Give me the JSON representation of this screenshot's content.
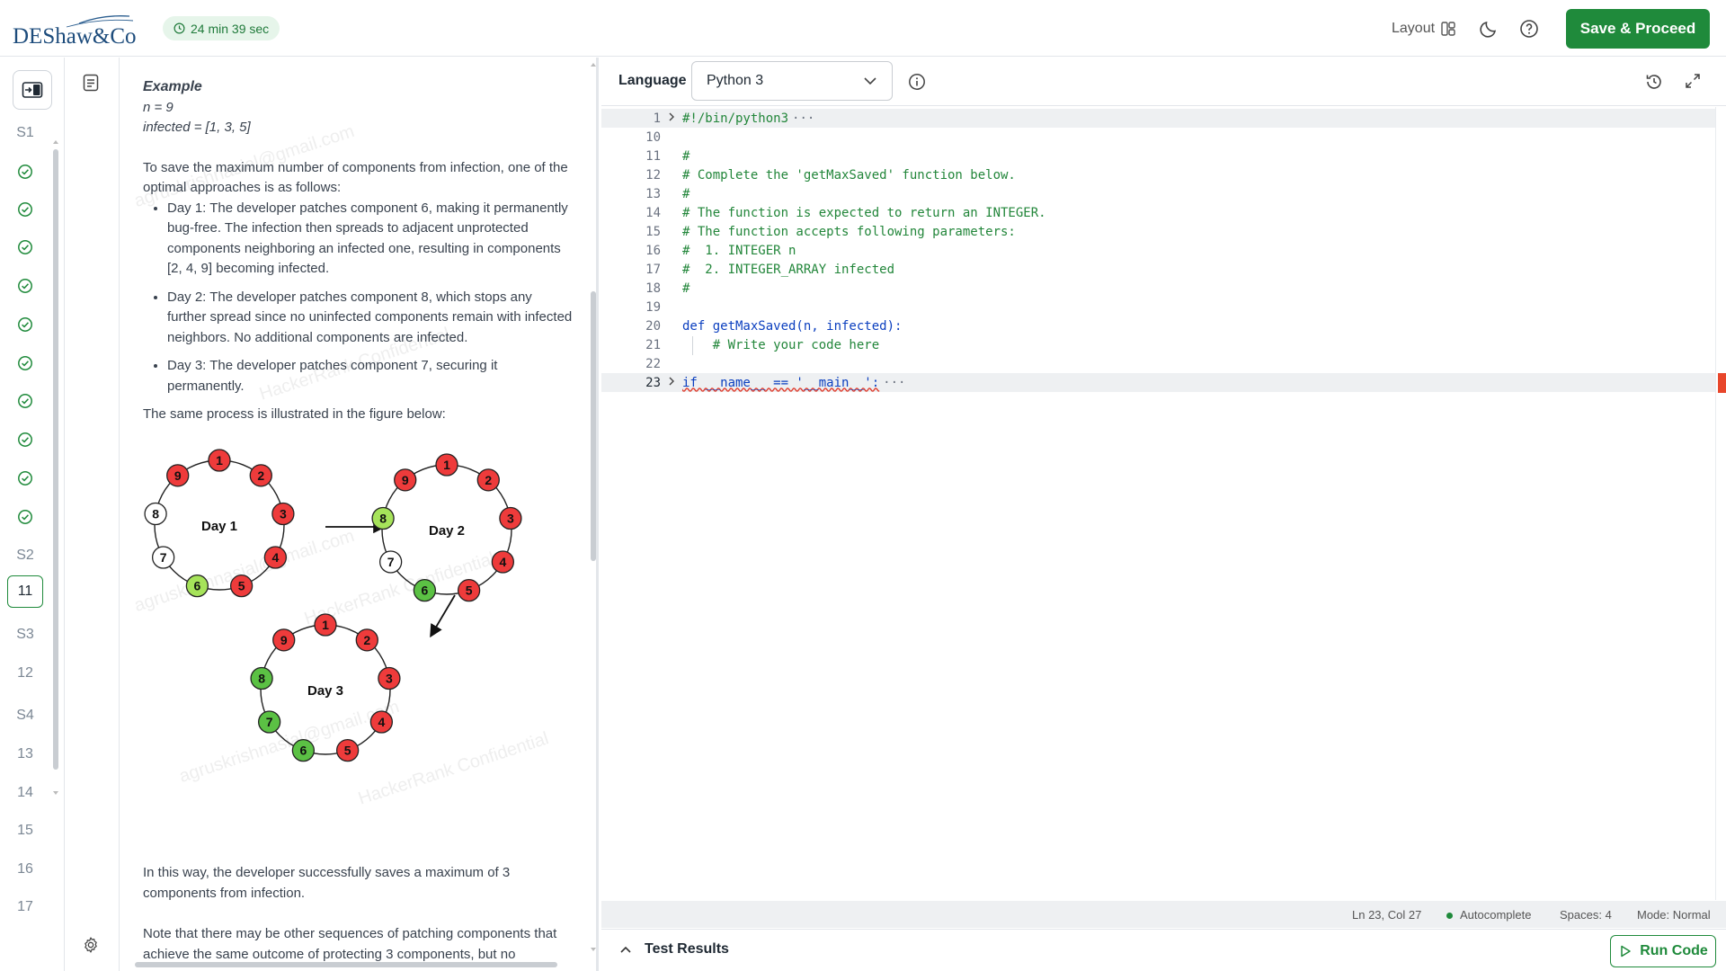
{
  "header": {
    "logo_text": "DEShaw&Co",
    "timer": "24 min 39 sec",
    "layout_label": "Layout",
    "save_label": "Save & Proceed"
  },
  "rail": {
    "sections": [
      {
        "label": "S1",
        "status": "section"
      },
      {
        "label": "",
        "status": "done"
      },
      {
        "label": "",
        "status": "done"
      },
      {
        "label": "",
        "status": "done"
      },
      {
        "label": "",
        "status": "done"
      },
      {
        "label": "",
        "status": "done"
      },
      {
        "label": "",
        "status": "done"
      },
      {
        "label": "",
        "status": "done"
      },
      {
        "label": "",
        "status": "done"
      },
      {
        "label": "",
        "status": "done"
      },
      {
        "label": "",
        "status": "done"
      },
      {
        "label": "S2",
        "status": "section"
      },
      {
        "label": "11",
        "status": "active"
      },
      {
        "label": "S3",
        "status": "section"
      },
      {
        "label": "12",
        "status": "normal"
      },
      {
        "label": "S4",
        "status": "section"
      },
      {
        "label": "13",
        "status": "normal"
      },
      {
        "label": "14",
        "status": "normal"
      },
      {
        "label": "15",
        "status": "normal"
      },
      {
        "label": "16",
        "status": "normal"
      },
      {
        "label": "17",
        "status": "normal"
      }
    ]
  },
  "problem": {
    "example_title": "Example",
    "example_n": "n = 9",
    "example_infected": "infected = [1, 3, 5]",
    "intro": "To save the maximum number of components from infection, one of the optimal approaches is as follows:",
    "steps": [
      "Day 1: The developer patches component 6, making it permanently bug-free. The infection then spreads to adjacent unprotected components neighboring an infected one, resulting in components [2, 4, 9] becoming infected.",
      "Day 2: The developer patches component 8, which stops any further spread since no uninfected components remain with infected neighbors. No additional components are infected.",
      "Day 3: The developer patches component 7, securing it permanently."
    ],
    "figure_caption": "The same process is illustrated in the figure below:",
    "conclusion": "In this way, the developer successfully saves a maximum of 3 components from infection.",
    "note": "Note that there may be other sequences of patching components that achieve the same outcome of protecting 3 components, but no",
    "watermarks": [
      "agruskrishnasial@gmail.com",
      "HackerRank Confidential"
    ]
  },
  "figure": {
    "days": [
      {
        "label": "Day 1",
        "states": {
          "1": "red",
          "2": "red",
          "3": "red",
          "4": "red",
          "5": "red",
          "6": "lime",
          "7": "white",
          "8": "white",
          "9": "red"
        }
      },
      {
        "label": "Day 2",
        "states": {
          "1": "red",
          "2": "red",
          "3": "red",
          "4": "red",
          "5": "red",
          "6": "green",
          "7": "white",
          "8": "lime",
          "9": "red"
        }
      },
      {
        "label": "Day 3",
        "states": {
          "1": "red",
          "2": "red",
          "3": "red",
          "4": "red",
          "5": "red",
          "6": "green",
          "7": "green",
          "8": "green",
          "9": "red"
        }
      }
    ],
    "colors": {
      "red": "#ee3b3b",
      "lime": "#a6e35a",
      "green": "#5bc144",
      "white": "#ffffff"
    }
  },
  "editor": {
    "language_label": "Language",
    "language_value": "Python 3",
    "lines": [
      {
        "n": "1",
        "text": "#!/bin/python3",
        "style": "cm",
        "fold": true,
        "hl": true,
        "ellipsis": true
      },
      {
        "n": "10",
        "text": "",
        "style": ""
      },
      {
        "n": "11",
        "text": "#",
        "style": "cm"
      },
      {
        "n": "12",
        "text": "# Complete the 'getMaxSaved' function below.",
        "style": "cm"
      },
      {
        "n": "13",
        "text": "#",
        "style": "cm"
      },
      {
        "n": "14",
        "text": "# The function is expected to return an INTEGER.",
        "style": "cm"
      },
      {
        "n": "15",
        "text": "# The function accepts following parameters:",
        "style": "cm"
      },
      {
        "n": "16",
        "text": "#  1. INTEGER n",
        "style": "cm"
      },
      {
        "n": "17",
        "text": "#  2. INTEGER_ARRAY infected",
        "style": "cm"
      },
      {
        "n": "18",
        "text": "#",
        "style": "cm"
      },
      {
        "n": "19",
        "text": "",
        "style": ""
      },
      {
        "n": "20",
        "text": "def getMaxSaved(n, infected):",
        "style": "def"
      },
      {
        "n": "21",
        "text": "    # Write your code here",
        "style": "cm"
      },
      {
        "n": "22",
        "text": "",
        "style": ""
      },
      {
        "n": "23",
        "text": "if __name__ == '__main__':",
        "style": "main",
        "fold": true,
        "hl": true,
        "ellipsis": true,
        "current": true
      }
    ],
    "ellipsis": "···"
  },
  "status": {
    "position": "Ln 23, Col 27",
    "autocomplete": "Autocomplete",
    "spaces": "Spaces: 4",
    "mode": "Mode: Normal"
  },
  "results": {
    "title": "Test Results",
    "run_label": "Run Code"
  }
}
